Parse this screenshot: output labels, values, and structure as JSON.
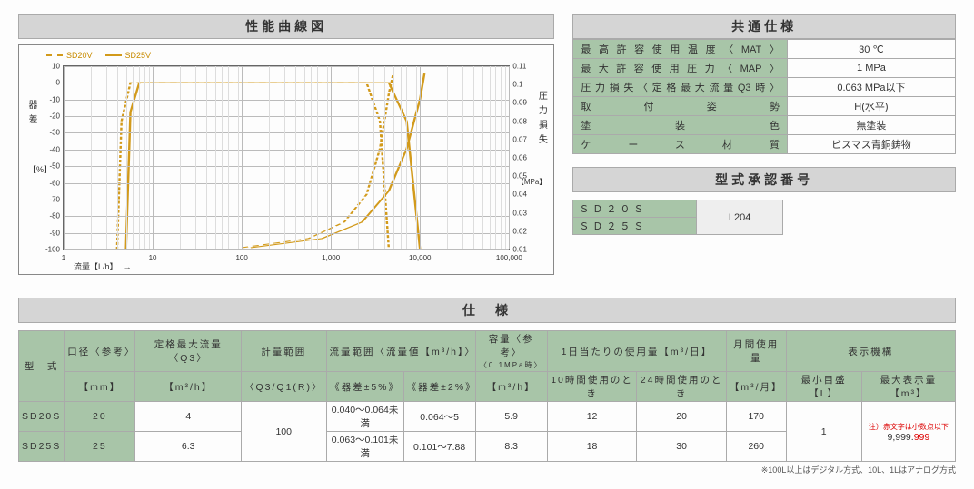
{
  "headers": {
    "chart": "性能曲線図",
    "common_spec": "共通仕様",
    "approval": "型式承認番号",
    "spec": "仕　様"
  },
  "chart_data": {
    "type": "line",
    "title": "性能曲線図",
    "legend": [
      "SD20V",
      "SD25V"
    ],
    "x_label": "流量【L/h】",
    "y_left_label": "器差",
    "y_left_unit": "【%】",
    "y_right_label": "圧力損失",
    "y_right_unit": "【MPa】",
    "x_scale": "log",
    "x_ticks": [
      1,
      10,
      100,
      1000,
      10000,
      100000
    ],
    "y_left_ticks": [
      10,
      0,
      -10,
      -20,
      -30,
      -40,
      -50,
      -60,
      -70,
      -80,
      -90,
      -100
    ],
    "y_right_ticks": [
      0.11,
      0.1,
      0.09,
      0.08,
      0.07,
      0.06,
      0.05,
      0.04,
      0.03,
      0.02,
      0.01
    ],
    "series": [
      {
        "name": "SD20V_器差",
        "axis": "left",
        "points": [
          [
            4,
            -100
          ],
          [
            7,
            -20
          ],
          [
            10,
            0
          ],
          [
            100,
            0
          ],
          [
            1000,
            0
          ],
          [
            2000,
            0
          ],
          [
            3000,
            -10
          ],
          [
            3500,
            -100
          ]
        ]
      },
      {
        "name": "SD25V_器差",
        "axis": "left",
        "points": [
          [
            5,
            -100
          ],
          [
            9,
            -15
          ],
          [
            12,
            0
          ],
          [
            100,
            0
          ],
          [
            1000,
            0
          ],
          [
            3000,
            0
          ],
          [
            4500,
            -10
          ],
          [
            5500,
            -100
          ]
        ]
      },
      {
        "name": "SD20V_圧損",
        "axis": "right",
        "points": [
          [
            100,
            0.002
          ],
          [
            500,
            0.008
          ],
          [
            1000,
            0.02
          ],
          [
            2000,
            0.05
          ],
          [
            3000,
            0.09
          ],
          [
            3500,
            0.105
          ]
        ]
      },
      {
        "name": "SD25V_圧損",
        "axis": "right",
        "points": [
          [
            100,
            0.002
          ],
          [
            700,
            0.008
          ],
          [
            1500,
            0.02
          ],
          [
            3000,
            0.05
          ],
          [
            4500,
            0.085
          ],
          [
            5500,
            0.105
          ]
        ]
      }
    ]
  },
  "common_spec": [
    {
      "label": "最高許容使用温度〈MAT〉",
      "value": "30 ℃"
    },
    {
      "label": "最大許容使用圧力〈MAP〉",
      "value": "1 MPa"
    },
    {
      "label": "圧力損失〈定格最大流量Q3時〉",
      "value": "0.063 MPa以下"
    },
    {
      "label": "取付姿勢",
      "value": "H(水平)"
    },
    {
      "label": "塗装色",
      "value": "無塗装"
    },
    {
      "label": "ケース材質",
      "value": "ビスマス青銅鋳物"
    }
  ],
  "approval": {
    "models": [
      "ＳＤ２０Ｓ",
      "ＳＤ２５Ｓ"
    ],
    "code": "L204"
  },
  "spec_table": {
    "head": {
      "model": "型　式",
      "dia": "口径〈参考〉",
      "dia_unit": "【mm】",
      "q3": "定格最大流量〈Q3〉",
      "q3_unit": "【m³/h】",
      "range": "計量範囲",
      "range_unit": "〈Q3/Q1(R)〉",
      "flow_range": "流量範囲〈流量値【m³/h】〉",
      "err5": "《器差±5%》",
      "err2": "《器差±2%》",
      "cap": "容量〈参考〉",
      "cap_sub": "〈0.1MPa時〉",
      "cap_unit": "【m³/h】",
      "daily": "1日当たりの使用量【m³/日】",
      "h10": "10時間使用のとき",
      "h24": "24時間使用のとき",
      "monthly": "月間使用量",
      "monthly_unit": "【m³/月】",
      "display": "表示機構",
      "min": "最小目盛【L】",
      "max": "最大表示量【m³】",
      "note": "注）赤文字は小数点以下",
      "maxval_int": "9,999.",
      "maxval_dec": "999"
    },
    "rows": [
      {
        "model": "SD20S",
        "dia": "20",
        "q3": "4",
        "range": "100",
        "r5": "0.040～0.064未満",
        "r2": "0.064～5",
        "cap": "5.9",
        "h10": "12",
        "h24": "20",
        "mon": "170",
        "min": "1"
      },
      {
        "model": "SD25S",
        "dia": "25",
        "q3": "6.3",
        "range": "100",
        "r5": "0.063～0.101未満",
        "r2": "0.101～7.88",
        "cap": "8.3",
        "h10": "18",
        "h24": "30",
        "mon": "260",
        "min": "1"
      }
    ],
    "footnote": "※100L以上はデジタル方式、10L、1Lはアナログ方式"
  }
}
